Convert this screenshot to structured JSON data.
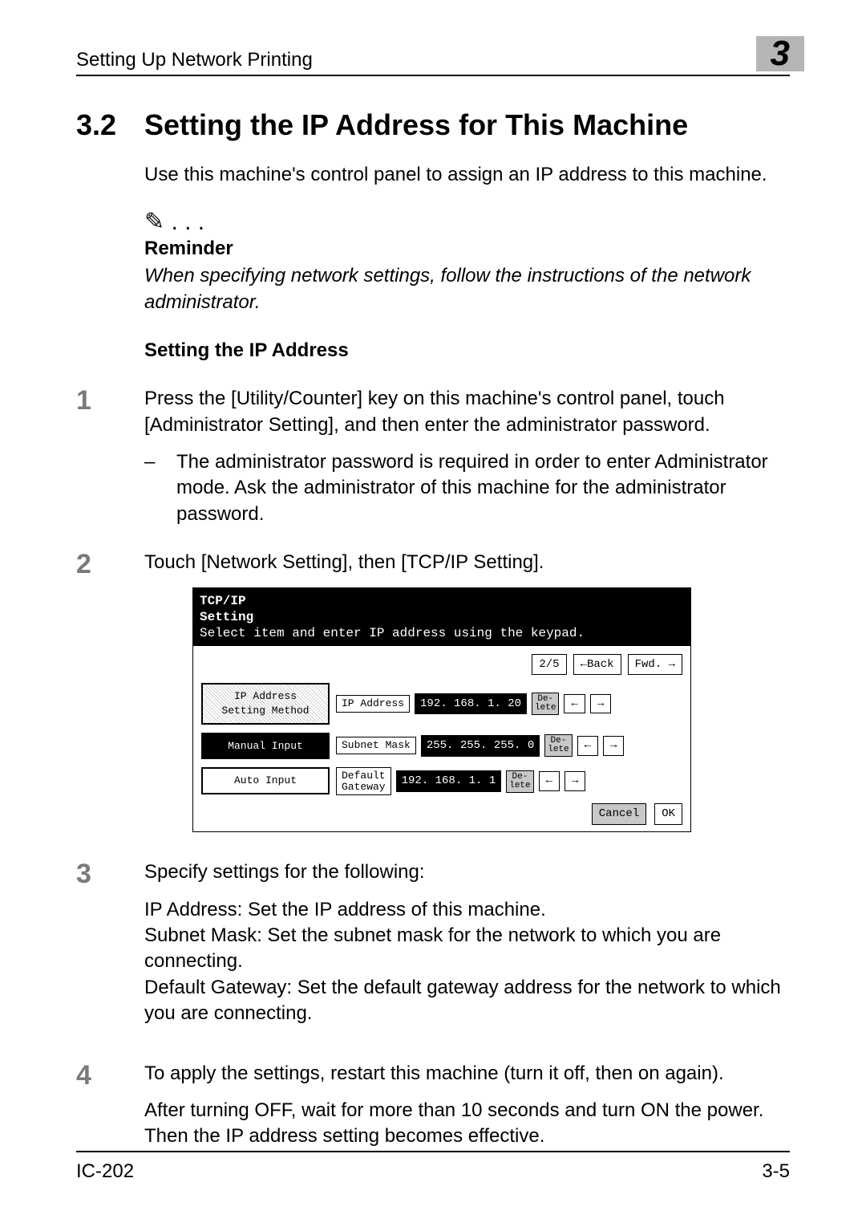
{
  "header": {
    "running_title": "Setting Up Network Printing",
    "chapter_number": "3"
  },
  "section": {
    "number": "3.2",
    "title": "Setting the IP Address for This Machine",
    "intro": "Use this machine's control panel to assign an IP address to this machine."
  },
  "reminder": {
    "heading": "Reminder",
    "text": "When specifying network settings, follow the instructions of the network administrator."
  },
  "subheading": "Setting the IP Address",
  "steps": [
    {
      "n": "1",
      "text": "Press the [Utility/Counter] key on this machine's control panel, touch [Administrator Setting], and then enter the administrator password.",
      "sub": "The administrator password is required in order to enter Administrator mode. Ask the administrator of this machine for the administrator password."
    },
    {
      "n": "2",
      "text": "Touch [Network Setting], then [TCP/IP Setting]."
    },
    {
      "n": "3",
      "text": "Specify settings for the following:",
      "after": "IP Address: Set the IP address of this machine.\nSubnet Mask: Set the subnet mask for the network to which you are connecting.\nDefault Gateway: Set the default gateway address for the network to which you are connecting."
    },
    {
      "n": "4",
      "text": "To apply the settings, restart this machine (turn it off, then on again).",
      "after": "After turning OFF, wait for more than 10 seconds and turn ON the power. Then the IP address setting becomes effective."
    }
  ],
  "screenshot": {
    "title1": "TCP/IP",
    "title2": "Setting",
    "instruction": "Select item and enter IP address using the keypad.",
    "pager": "2/5",
    "back": "←Back",
    "fwd": "Fwd. →",
    "left": {
      "header": "IP Address\nSetting Method",
      "manual": "Manual Input",
      "auto": "Auto Input"
    },
    "rows": {
      "ip_label": "IP Address",
      "ip_value": "192. 168.    1.  20",
      "mask_label": "Subnet Mask",
      "mask_value": "255. 255. 255.    0",
      "gw_label": "Default\nGateway",
      "gw_value": "192. 168.    1.    1",
      "delete": "De-\nlete",
      "left_arrow": "←",
      "right_arrow": "→"
    },
    "cancel": "Cancel",
    "ok": "OK"
  },
  "footer": {
    "left": "IC-202",
    "right": "3-5"
  }
}
